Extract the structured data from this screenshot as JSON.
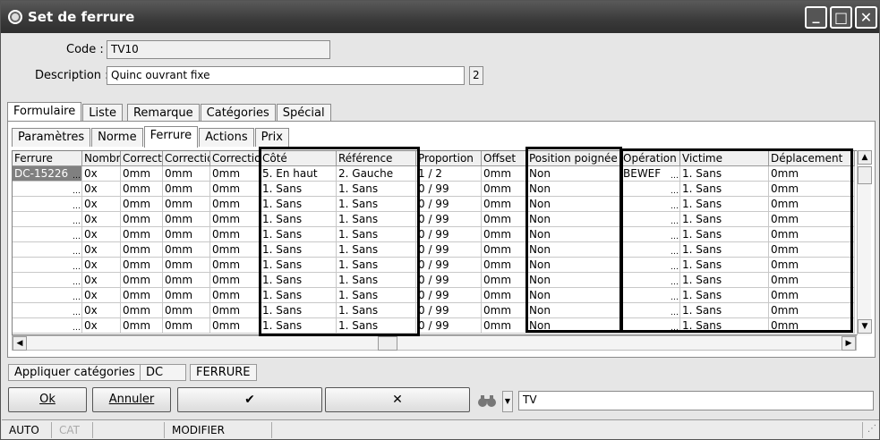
{
  "window": {
    "title": "Set de ferrure",
    "min": "_",
    "max": "□",
    "close": "✕"
  },
  "form": {
    "code_label": "Code :",
    "code_value": "TV10",
    "desc_label": "Description :",
    "desc_value": "Quinc ouvrant fixe",
    "desc_count": "2"
  },
  "tabs": [
    "Formulaire",
    "Liste",
    "Remarque",
    "Catégories",
    "Spécial"
  ],
  "subtabs": [
    "Paramètres",
    "Norme",
    "Ferrure",
    "Actions",
    "Prix"
  ],
  "columns": [
    "Ferrure",
    "Nombr",
    "Correct",
    "Correctio",
    "Correctio",
    "Côté",
    "Référence",
    "Proportion",
    "Offset",
    "Position poignée",
    "Opération",
    "Victime",
    "Déplacement"
  ],
  "rows": [
    [
      "DC-15226",
      "0x",
      "0mm",
      "0mm",
      "0mm",
      "5. En haut",
      "2. Gauche",
      "1 / 2",
      "0mm",
      "Non",
      "BEWEF",
      "1. Sans",
      "0mm"
    ],
    [
      "",
      "0x",
      "0mm",
      "0mm",
      "0mm",
      "1. Sans",
      "1. Sans",
      "0 / 99",
      "0mm",
      "Non",
      "",
      "1. Sans",
      "0mm"
    ],
    [
      "",
      "0x",
      "0mm",
      "0mm",
      "0mm",
      "1. Sans",
      "1. Sans",
      "0 / 99",
      "0mm",
      "Non",
      "",
      "1. Sans",
      "0mm"
    ],
    [
      "",
      "0x",
      "0mm",
      "0mm",
      "0mm",
      "1. Sans",
      "1. Sans",
      "0 / 99",
      "0mm",
      "Non",
      "",
      "1. Sans",
      "0mm"
    ],
    [
      "",
      "0x",
      "0mm",
      "0mm",
      "0mm",
      "1. Sans",
      "1. Sans",
      "0 / 99",
      "0mm",
      "Non",
      "",
      "1. Sans",
      "0mm"
    ],
    [
      "",
      "0x",
      "0mm",
      "0mm",
      "0mm",
      "1. Sans",
      "1. Sans",
      "0 / 99",
      "0mm",
      "Non",
      "",
      "1. Sans",
      "0mm"
    ],
    [
      "",
      "0x",
      "0mm",
      "0mm",
      "0mm",
      "1. Sans",
      "1. Sans",
      "0 / 99",
      "0mm",
      "Non",
      "",
      "1. Sans",
      "0mm"
    ],
    [
      "",
      "0x",
      "0mm",
      "0mm",
      "0mm",
      "1. Sans",
      "1. Sans",
      "0 / 99",
      "0mm",
      "Non",
      "",
      "1. Sans",
      "0mm"
    ],
    [
      "",
      "0x",
      "0mm",
      "0mm",
      "0mm",
      "1. Sans",
      "1. Sans",
      "0 / 99",
      "0mm",
      "Non",
      "",
      "1. Sans",
      "0mm"
    ],
    [
      "",
      "0x",
      "0mm",
      "0mm",
      "0mm",
      "1. Sans",
      "1. Sans",
      "0 / 99",
      "0mm",
      "Non",
      "",
      "1. Sans",
      "0mm"
    ],
    [
      "",
      "0x",
      "0mm",
      "0mm",
      "0mm",
      "1. Sans",
      "1. Sans",
      "0 / 99",
      "0mm",
      "Non",
      "",
      "1. Sans",
      "0mm"
    ]
  ],
  "chips": {
    "apply": "Appliquer catégories",
    "dc": "DC",
    "ferrure": "FERRURE"
  },
  "buttons": {
    "ok": "Ok",
    "cancel": "Annuler",
    "check": "✔",
    "cross": "✕"
  },
  "search": {
    "value": "TV"
  },
  "status": {
    "auto": "AUTO",
    "cat": "CAT",
    "mode": "MODIFIER"
  }
}
